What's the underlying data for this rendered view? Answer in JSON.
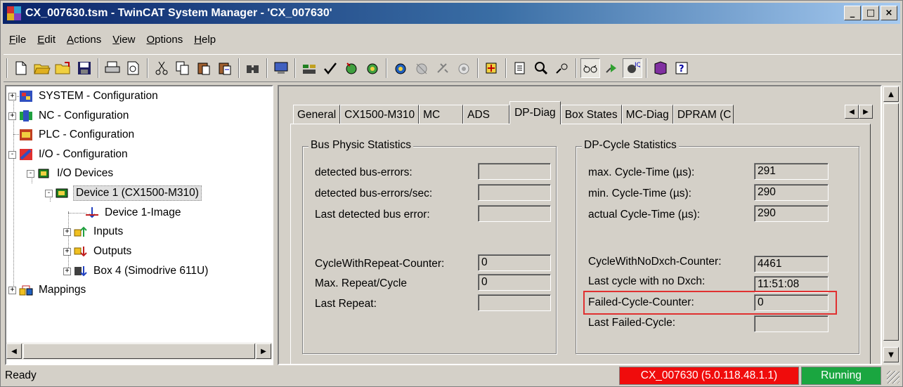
{
  "window": {
    "title": "CX_007630.tsm - TwinCAT System Manager - 'CX_007630'",
    "minimize_glyph": "_",
    "maximize_glyph": "□",
    "close_glyph": "×"
  },
  "menu": [
    {
      "label": "File",
      "u": "F",
      "rest": "ile"
    },
    {
      "label": "Edit",
      "u": "E",
      "rest": "dit"
    },
    {
      "label": "Actions",
      "u": "A",
      "rest": "ctions"
    },
    {
      "label": "View",
      "u": "V",
      "rest": "iew"
    },
    {
      "label": "Options",
      "u": "O",
      "rest": "ptions"
    },
    {
      "label": "Help",
      "u": "H",
      "rest": "elp"
    }
  ],
  "toolbar_icons": [
    "new-icon",
    "open-icon",
    "open-folder-icon",
    "save-icon",
    "print-icon",
    "print-preview-icon",
    "cut-icon",
    "copy-icon",
    "paste-icon",
    "paste-with-links-icon",
    "find-icon",
    "target-system-icon",
    "generate-mappings-icon",
    "check-configuration-icon",
    "activate-configuration-icon",
    "restart-run-mode-icon",
    "reload-devices-icon",
    "scan-devices-icon",
    "toggle-free-run-icon",
    "show-online-data-icon",
    "add-variable-icon",
    "show-sub-items-icon",
    "zoom-icon",
    "search-item-icon",
    "online-watch-icon",
    "force-icon",
    "info-icon",
    "help-book-icon",
    "help-icon"
  ],
  "tree": {
    "items": [
      {
        "label": "SYSTEM - Configuration",
        "box": "+"
      },
      {
        "label": "NC - Configuration",
        "box": "+"
      },
      {
        "label": "PLC - Configuration",
        "box": ""
      },
      {
        "label": "I/O - Configuration",
        "box": "-"
      },
      {
        "label": "I/O Devices",
        "box": "-"
      },
      {
        "label": "Device 1 (CX1500-M310)",
        "box": "-"
      },
      {
        "label": "Device 1-Image",
        "box": ""
      },
      {
        "label": "Inputs",
        "box": "+"
      },
      {
        "label": "Outputs",
        "box": "+"
      },
      {
        "label": "Box 4 (Simodrive 611U)",
        "box": "+"
      },
      {
        "label": "Mappings",
        "box": "+"
      }
    ]
  },
  "tabs": [
    "General",
    "CX1500-M310",
    "MC",
    "ADS",
    "DP-Diag",
    "Box States",
    "MC-Diag",
    "DPRAM (C"
  ],
  "active_tab": "DP-Diag",
  "bus_stats": {
    "title": "Bus Physic Statistics",
    "rows": [
      {
        "label": "detected bus-errors:",
        "value": ""
      },
      {
        "label": "detected bus-errors/sec:",
        "value": ""
      },
      {
        "label": "Last detected bus error:",
        "value": ""
      },
      {
        "label": "CycleWithRepeat-Counter:",
        "value": "0"
      },
      {
        "label": "Max. Repeat/Cycle",
        "value": "0"
      },
      {
        "label": "Last Repeat:",
        "value": ""
      }
    ]
  },
  "cycle_stats": {
    "title": "DP-Cycle Statistics",
    "rows": [
      {
        "label": "max. Cycle-Time (µs):",
        "value": "291"
      },
      {
        "label": "min. Cycle-Time (µs):",
        "value": "290"
      },
      {
        "label": "actual Cycle-Time (µs):",
        "value": "290"
      },
      {
        "label": "CycleWithNoDxch-Counter:",
        "value": "4461"
      },
      {
        "label": "Last cycle with no Dxch:",
        "value": "11:51:08"
      },
      {
        "label": "Failed-Cycle-Counter:",
        "value": "0"
      },
      {
        "label": "Last Failed-Cycle:",
        "value": ""
      }
    ]
  },
  "status": {
    "ready": "Ready",
    "target": "CX_007630 (5.0.118.48.1.1)",
    "state": "Running",
    "target_color": "#f00c0c",
    "state_color": "#1aa640"
  }
}
